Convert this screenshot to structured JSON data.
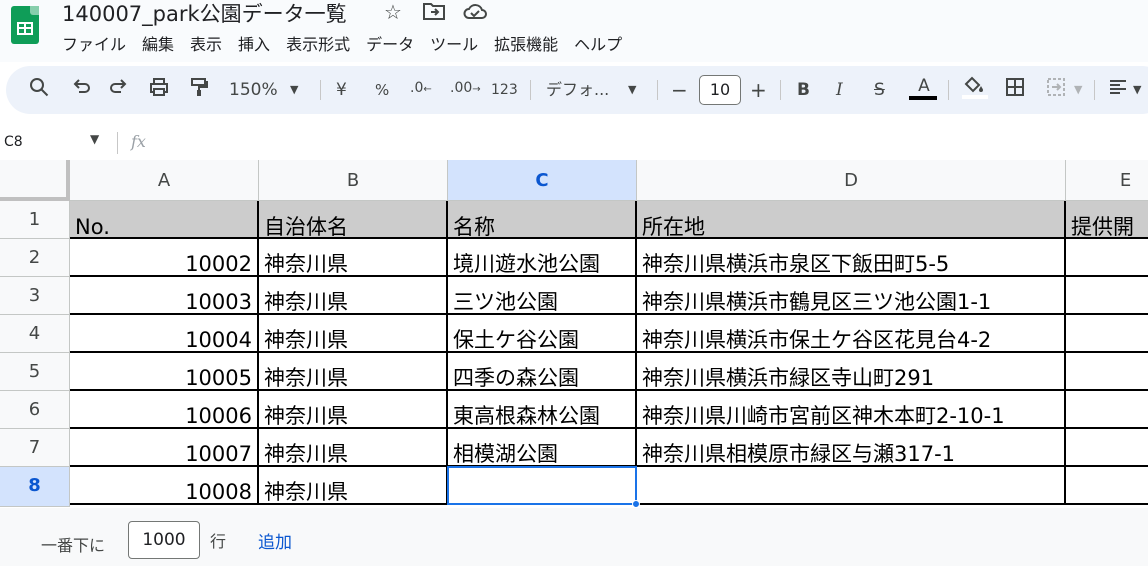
{
  "app": {
    "title": "140007_park公園データ一覧",
    "title_icons": [
      "star-icon",
      "move-to-folder-icon",
      "cloud-status-icon"
    ]
  },
  "menu": [
    "ファイル",
    "編集",
    "表示",
    "挿入",
    "表示形式",
    "データ",
    "ツール",
    "拡張機能",
    "ヘルプ"
  ],
  "toolbar": {
    "zoom": "150%",
    "currency": "¥",
    "percent": "%",
    "decrease_decimal": ".0",
    "increase_decimal": ".00",
    "number_format": "123",
    "font": "デフォ...",
    "font_size": "10",
    "bold": "B",
    "italic": "I",
    "strike": "S",
    "text_color": "A",
    "accent_color": "#000000"
  },
  "formula_bar": {
    "name_box": "C8",
    "fx": "fx",
    "content": ""
  },
  "grid": {
    "columns": [
      "A",
      "B",
      "C",
      "D",
      "E"
    ],
    "selected_column": "C",
    "rows": [
      "1",
      "2",
      "3",
      "4",
      "5",
      "6",
      "7",
      "8"
    ],
    "selected_row": "8",
    "header": [
      "No.",
      "自治体名",
      "名称",
      "所在地",
      "提供開"
    ],
    "data": [
      [
        "10002",
        "神奈川県",
        "境川遊水池公園",
        "神奈川県横浜市泉区下飯田町5-5"
      ],
      [
        "10003",
        "神奈川県",
        "三ツ池公園",
        "神奈川県横浜市鶴見区三ツ池公園1-1"
      ],
      [
        "10004",
        "神奈川県",
        "保土ケ谷公園",
        "神奈川県横浜市保土ケ谷区花見台4-2"
      ],
      [
        "10005",
        "神奈川県",
        "四季の森公園",
        "神奈川県横浜市緑区寺山町291"
      ],
      [
        "10006",
        "神奈川県",
        "東高根森林公園",
        "神奈川県川崎市宮前区神木本町2-10-1"
      ],
      [
        "10007",
        "神奈川県",
        "相模湖公園",
        "神奈川県相模原市緑区与瀬317-1"
      ],
      [
        "10008",
        "神奈川県",
        "",
        ""
      ]
    ]
  },
  "add_rows": {
    "label": "一番下に",
    "count": "1000",
    "unit": "行",
    "button": "追加"
  }
}
